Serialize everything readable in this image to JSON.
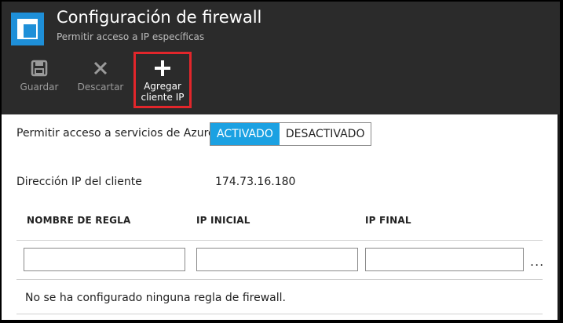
{
  "header": {
    "title": "Configuración de firewall",
    "subtitle": "Permitir acceso a IP específicas"
  },
  "toolbar": {
    "save_label": "Guardar",
    "discard_label": "Descartar",
    "add_client_line1": "Agregar",
    "add_client_line2": "cliente IP"
  },
  "azure_access": {
    "label": "Permitir acceso a servicios de Azure",
    "on_label": "ACTIVADO",
    "off_label": "DESACTIVADO",
    "selected": "ACTIVADO"
  },
  "client_ip": {
    "label": "Dirección IP del cliente",
    "value": "174.73.16.180"
  },
  "rules_table": {
    "columns": [
      "NOMBRE DE REGLA",
      "IP INICIAL",
      "IP FINAL"
    ],
    "new_row": {
      "rule_name": "",
      "start_ip": "",
      "end_ip": ""
    },
    "more_label": "...",
    "empty_message": "No se ha configurado ninguna regla de firewall."
  },
  "colors": {
    "header_bg": "#2b2b2b",
    "accent": "#1ba1e2",
    "highlight": "#e2262b"
  },
  "icons": {
    "app": "firewall-blade-icon",
    "save": "save-icon",
    "discard": "close-icon",
    "add": "plus-icon"
  }
}
